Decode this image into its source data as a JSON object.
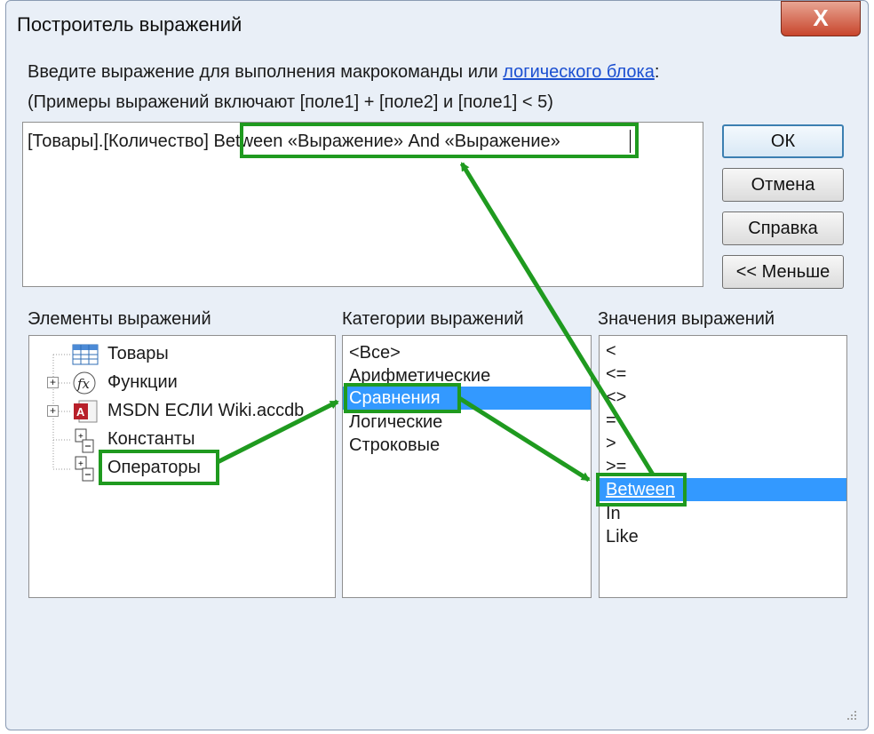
{
  "window": {
    "title": "Построитель выражений",
    "close_symbol": "X"
  },
  "instructions": {
    "line1_prefix": "Введите выражение для выполнения макрокоманды или ",
    "line1_link": "логического блока",
    "line1_suffix": ":",
    "line2": "(Примеры выражений включают [поле1] + [поле2] и [поле1] < 5)"
  },
  "expression": {
    "prefix": "[Товары].[Количество]",
    "inserted": "Between «Выражение» And «Выражение»"
  },
  "buttons": {
    "ok": "ОК",
    "cancel": "Отмена",
    "help": "Справка",
    "less": "<< Меньше"
  },
  "panels": {
    "elements_label": "Элементы выражений",
    "categories_label": "Категории выражений",
    "values_label": "Значения выражений"
  },
  "elements": [
    {
      "label": "Товары",
      "icon": "table-icon"
    },
    {
      "label": "Функции",
      "icon": "function-icon"
    },
    {
      "label": "MSDN ЕСЛИ Wiki.accdb",
      "icon": "access-db-icon"
    },
    {
      "label": "Константы",
      "icon": "constants-icon"
    },
    {
      "label": "Операторы",
      "icon": "operators-icon"
    }
  ],
  "categories": [
    "<Все>",
    "Арифметические",
    "Сравнения",
    "Логические",
    "Строковые"
  ],
  "values": [
    "<",
    "<=",
    "<>",
    "=",
    ">",
    ">=",
    "Between",
    "In",
    "Like"
  ],
  "selection": {
    "category": "Сравнения",
    "value": "Between"
  },
  "colors": {
    "selection": "#3399ff",
    "annotation": "#1f9a1f"
  }
}
